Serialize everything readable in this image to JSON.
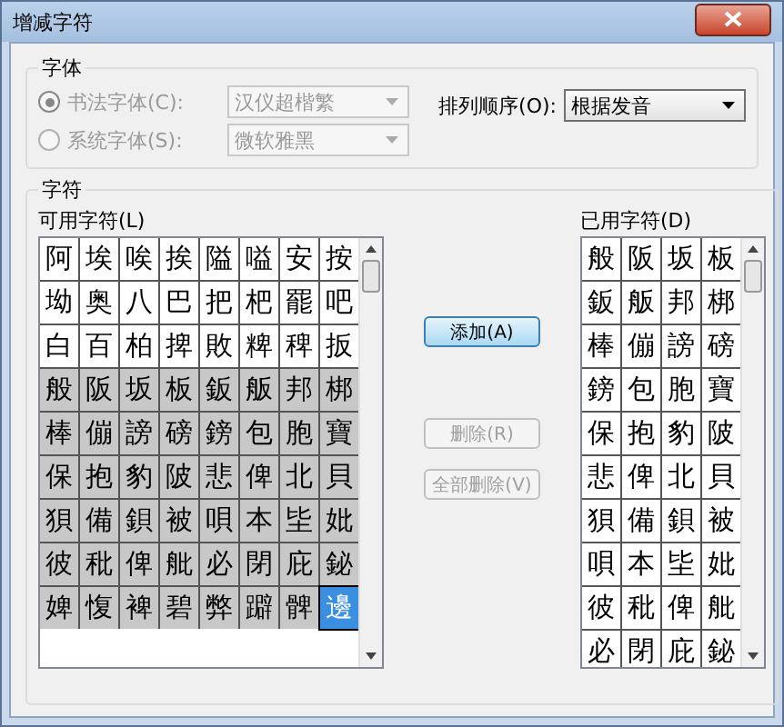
{
  "window": {
    "title": "增减字符"
  },
  "font_group": {
    "title": "字体",
    "options": [
      {
        "label": "书法字体(C):",
        "selected": true,
        "disabled": true,
        "dropdown": "汉仪超楷繁"
      },
      {
        "label": "系统字体(S):",
        "selected": false,
        "disabled": true,
        "dropdown": "微软雅黑"
      }
    ],
    "sort": {
      "label": "排列顺序(O):",
      "value": "根据发音"
    }
  },
  "chars_group": {
    "title": "字符",
    "available": {
      "label": "可用字符(L)",
      "rows": [
        [
          {
            "char": "阿",
            "selected": false,
            "current": false
          },
          {
            "char": "埃",
            "selected": false,
            "current": false
          },
          {
            "char": "唉",
            "selected": false,
            "current": false
          },
          {
            "char": "挨",
            "selected": false,
            "current": false
          },
          {
            "char": "隘",
            "selected": false,
            "current": false
          },
          {
            "char": "嗌",
            "selected": false,
            "current": false
          },
          {
            "char": "安",
            "selected": false,
            "current": false
          },
          {
            "char": "按",
            "selected": false,
            "current": false
          }
        ],
        [
          {
            "char": "坳",
            "selected": false,
            "current": false
          },
          {
            "char": "奥",
            "selected": false,
            "current": false
          },
          {
            "char": "八",
            "selected": false,
            "current": false
          },
          {
            "char": "巴",
            "selected": false,
            "current": false
          },
          {
            "char": "把",
            "selected": false,
            "current": false
          },
          {
            "char": "杷",
            "selected": false,
            "current": false
          },
          {
            "char": "罷",
            "selected": false,
            "current": false
          },
          {
            "char": "吧",
            "selected": false,
            "current": false
          }
        ],
        [
          {
            "char": "白",
            "selected": false,
            "current": false
          },
          {
            "char": "百",
            "selected": false,
            "current": false
          },
          {
            "char": "柏",
            "selected": false,
            "current": false
          },
          {
            "char": "捭",
            "selected": false,
            "current": false
          },
          {
            "char": "敗",
            "selected": false,
            "current": false
          },
          {
            "char": "粺",
            "selected": false,
            "current": false
          },
          {
            "char": "稗",
            "selected": false,
            "current": false
          },
          {
            "char": "扳",
            "selected": false,
            "current": false
          }
        ],
        [
          {
            "char": "般",
            "selected": true,
            "current": false
          },
          {
            "char": "阪",
            "selected": true,
            "current": false
          },
          {
            "char": "坂",
            "selected": true,
            "current": false
          },
          {
            "char": "板",
            "selected": true,
            "current": false
          },
          {
            "char": "鈑",
            "selected": true,
            "current": false
          },
          {
            "char": "舨",
            "selected": true,
            "current": false
          },
          {
            "char": "邦",
            "selected": true,
            "current": false
          },
          {
            "char": "梆",
            "selected": true,
            "current": false
          }
        ],
        [
          {
            "char": "棒",
            "selected": true,
            "current": false
          },
          {
            "char": "傰",
            "selected": true,
            "current": false
          },
          {
            "char": "謗",
            "selected": true,
            "current": false
          },
          {
            "char": "磅",
            "selected": true,
            "current": false
          },
          {
            "char": "鎊",
            "selected": true,
            "current": false
          },
          {
            "char": "包",
            "selected": true,
            "current": false
          },
          {
            "char": "胞",
            "selected": true,
            "current": false
          },
          {
            "char": "寶",
            "selected": true,
            "current": false
          }
        ],
        [
          {
            "char": "保",
            "selected": true,
            "current": false
          },
          {
            "char": "抱",
            "selected": true,
            "current": false
          },
          {
            "char": "豹",
            "selected": true,
            "current": false
          },
          {
            "char": "陂",
            "selected": true,
            "current": false
          },
          {
            "char": "悲",
            "selected": true,
            "current": false
          },
          {
            "char": "俾",
            "selected": true,
            "current": false
          },
          {
            "char": "北",
            "selected": true,
            "current": false
          },
          {
            "char": "貝",
            "selected": true,
            "current": false
          }
        ],
        [
          {
            "char": "狽",
            "selected": true,
            "current": false
          },
          {
            "char": "備",
            "selected": true,
            "current": false
          },
          {
            "char": "鋇",
            "selected": true,
            "current": false
          },
          {
            "char": "被",
            "selected": true,
            "current": false
          },
          {
            "char": "唄",
            "selected": true,
            "current": false
          },
          {
            "char": "本",
            "selected": true,
            "current": false
          },
          {
            "char": "坒",
            "selected": true,
            "current": false
          },
          {
            "char": "妣",
            "selected": true,
            "current": false
          }
        ],
        [
          {
            "char": "彼",
            "selected": true,
            "current": false
          },
          {
            "char": "秕",
            "selected": true,
            "current": false
          },
          {
            "char": "俾",
            "selected": true,
            "current": false
          },
          {
            "char": "舭",
            "selected": true,
            "current": false
          },
          {
            "char": "必",
            "selected": true,
            "current": false
          },
          {
            "char": "閉",
            "selected": true,
            "current": false
          },
          {
            "char": "庇",
            "selected": true,
            "current": false
          },
          {
            "char": "鉍",
            "selected": true,
            "current": false
          }
        ],
        [
          {
            "char": "婢",
            "selected": true,
            "current": false
          },
          {
            "char": "愎",
            "selected": true,
            "current": false
          },
          {
            "char": "裨",
            "selected": true,
            "current": false
          },
          {
            "char": "碧",
            "selected": true,
            "current": false
          },
          {
            "char": "弊",
            "selected": true,
            "current": false
          },
          {
            "char": "躃",
            "selected": true,
            "current": false
          },
          {
            "char": "髀",
            "selected": true,
            "current": false
          },
          {
            "char": "邊",
            "selected": true,
            "current": true
          }
        ]
      ]
    },
    "buttons": [
      {
        "label": "添加(A)",
        "disabled": false
      },
      {
        "label": "删除(R)",
        "disabled": true
      },
      {
        "label": "全部删除(V)",
        "disabled": true
      }
    ],
    "used": {
      "label": "已用字符(D)",
      "rows": [
        [
          "般",
          "阪",
          "坂",
          "板"
        ],
        [
          "鈑",
          "舨",
          "邦",
          "梆"
        ],
        [
          "棒",
          "傰",
          "謗",
          "磅"
        ],
        [
          "鎊",
          "包",
          "胞",
          "寶"
        ],
        [
          "保",
          "抱",
          "豹",
          "陂"
        ],
        [
          "悲",
          "俾",
          "北",
          "貝"
        ],
        [
          "狽",
          "備",
          "鋇",
          "被"
        ],
        [
          "唄",
          "本",
          "坒",
          "妣"
        ],
        [
          "彼",
          "秕",
          "俾",
          "舭"
        ],
        [
          "必",
          "閉",
          "庇",
          "鉍"
        ]
      ]
    }
  }
}
